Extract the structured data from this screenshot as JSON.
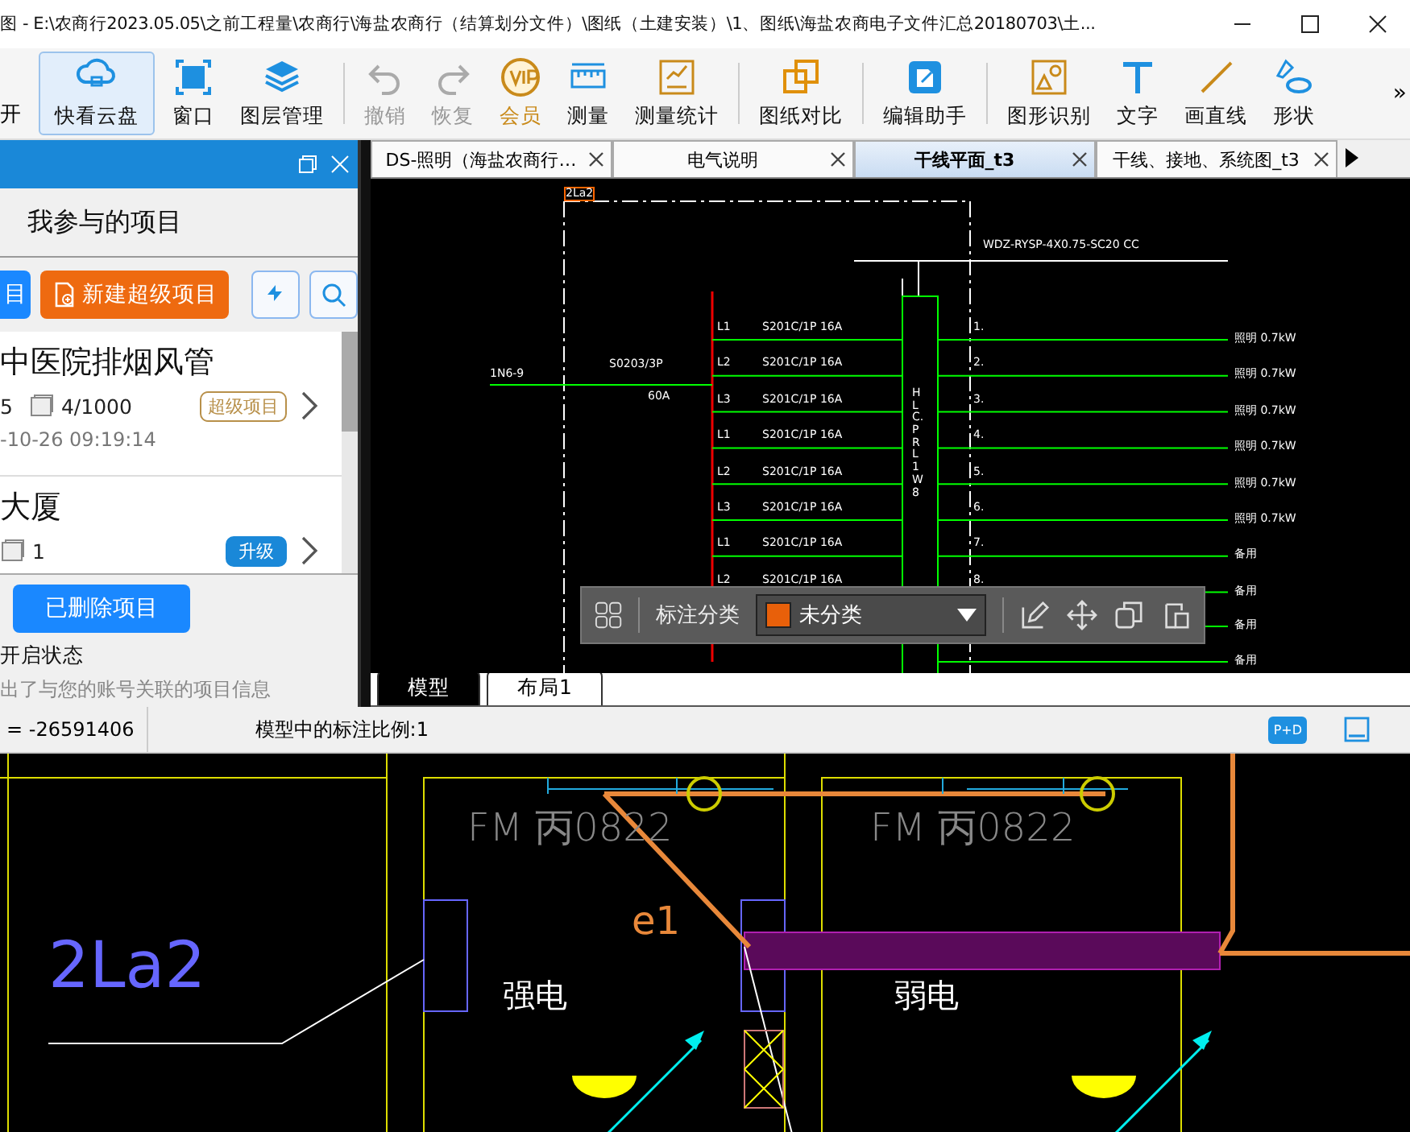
{
  "window": {
    "title": "图 - E:\\农商行2023.05.05\\之前工程量\\农商行\\海盐农商行（结算划分文件）\\图纸（土建安装）\\1、图纸\\海盐农商电子文件汇总20180703\\土..."
  },
  "toolbar": {
    "cut_label": "开",
    "items": [
      {
        "label": "快看云盘",
        "selected": true,
        "disabled": false,
        "premium": false
      },
      {
        "label": "窗口",
        "selected": false,
        "disabled": false,
        "premium": false
      },
      {
        "label": "图层管理",
        "selected": false,
        "disabled": false,
        "premium": false
      },
      {
        "label": "撤销",
        "selected": false,
        "disabled": true,
        "premium": false
      },
      {
        "label": "恢复",
        "selected": false,
        "disabled": true,
        "premium": false
      },
      {
        "label": "会员",
        "selected": false,
        "disabled": false,
        "premium": true
      },
      {
        "label": "测量",
        "selected": false,
        "disabled": false,
        "premium": false
      },
      {
        "label": "测量统计",
        "selected": false,
        "disabled": false,
        "premium": false
      },
      {
        "label": "图纸对比",
        "selected": false,
        "disabled": false,
        "premium": false
      },
      {
        "label": "编辑助手",
        "selected": false,
        "disabled": false,
        "premium": false
      },
      {
        "label": "图形识别",
        "selected": false,
        "disabled": false,
        "premium": false
      },
      {
        "label": "文字",
        "selected": false,
        "disabled": false,
        "premium": false
      },
      {
        "label": "画直线",
        "selected": false,
        "disabled": false,
        "premium": false
      },
      {
        "label": "形状",
        "selected": false,
        "disabled": false,
        "premium": false
      }
    ],
    "more": "»"
  },
  "project_panel": {
    "title": "我参与的项目",
    "cut_button": "目",
    "new_button": "新建超级项目",
    "projects": [
      {
        "name": "中医院排烟风管",
        "members": "5",
        "files": "4/1000",
        "tag": "超级项目",
        "tag_filled": false,
        "date": "-10-26 09:19:14"
      },
      {
        "name": "大厦",
        "files": "1",
        "tag": "升级",
        "tag_filled": true
      }
    ],
    "deleted_button": "已删除项目",
    "status_label": "开启状态",
    "note": "出了与您的账号关联的项目信息"
  },
  "drawing_tabs": [
    {
      "label": "DS-照明（海盐农商行…",
      "selected": false
    },
    {
      "label": "电气说明",
      "selected": false
    },
    {
      "label": "干线平面_t3",
      "selected": true
    },
    {
      "label": "干线、接地、系统图_t3",
      "selected": false
    }
  ],
  "schematic": {
    "panel_label": "2La2",
    "feeder": "WDZ-RYSP-4X0.75-SC20 CC",
    "incoming": "1N6-9",
    "main_breaker": "S0203/3P",
    "main_rating": "60A",
    "box_label": "HLC.PRL1W8",
    "circuits": [
      {
        "phase": "L1",
        "breaker": "S201C/1P 16A",
        "number": "1.",
        "load": "照明 0.7kW"
      },
      {
        "phase": "L2",
        "breaker": "S201C/1P 16A",
        "number": "2.",
        "load": "照明 0.7kW"
      },
      {
        "phase": "L3",
        "breaker": "S201C/1P 16A",
        "number": "3.",
        "load": "照明 0.7kW"
      },
      {
        "phase": "L1",
        "breaker": "S201C/1P 16A",
        "number": "4.",
        "load": "照明 0.7kW"
      },
      {
        "phase": "L2",
        "breaker": "S201C/1P 16A",
        "number": "5.",
        "load": "照明 0.7kW"
      },
      {
        "phase": "L3",
        "breaker": "S201C/1P 16A",
        "number": "6.",
        "load": "照明 0.7kW"
      },
      {
        "phase": "L1",
        "breaker": "S201C/1P 16A",
        "number": "7.",
        "load": "备用"
      },
      {
        "phase": "L2",
        "breaker": "S201C/1P 16A",
        "number": "8.",
        "load": "备用"
      }
    ],
    "hidden_loads": [
      "备用",
      "备用"
    ]
  },
  "annotation_bar": {
    "label": "标注分类",
    "category": "未分类"
  },
  "layout_tabs": [
    {
      "label": "模型",
      "selected": true
    },
    {
      "label": "布局1",
      "selected": false
    }
  ],
  "status_bar": {
    "coordinate": "= -26591406",
    "scale": "模型中的标注比例:1",
    "mode_badge": "P+D"
  },
  "floor_plan": {
    "door_labels": [
      "FM 丙0822",
      "FM 丙0822"
    ],
    "panel_label": "2La2",
    "marker": "e1",
    "rooms": [
      "强电",
      "弱电"
    ]
  }
}
